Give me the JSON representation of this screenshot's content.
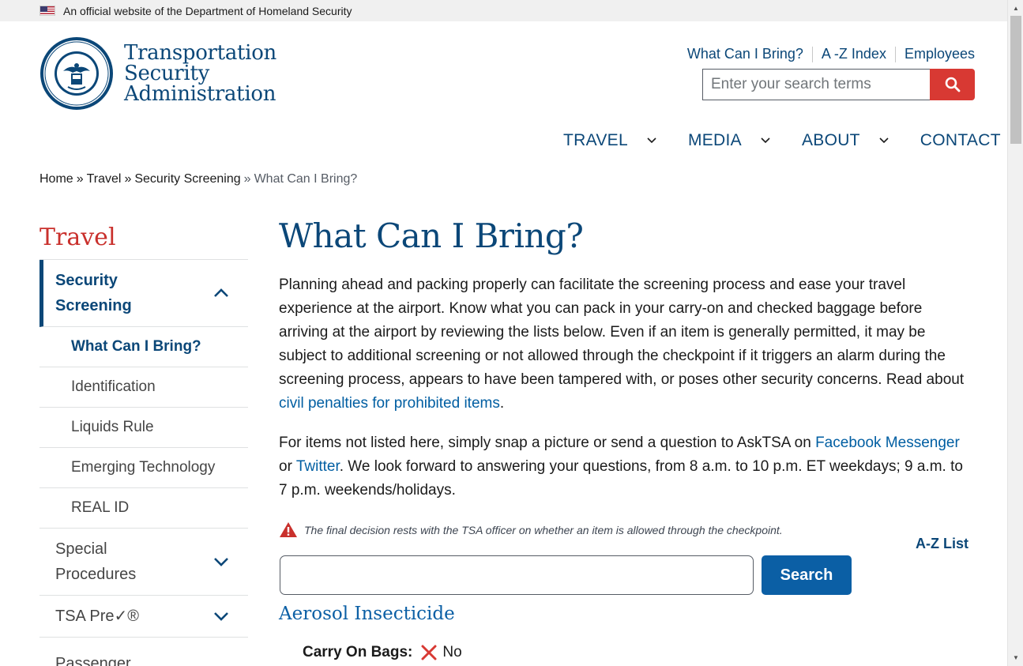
{
  "banner": {
    "text": "An official website of the Department of Homeland Security"
  },
  "logo": {
    "line1": "Transportation",
    "line2": "Security",
    "line3": "Administration"
  },
  "utility_links": [
    {
      "label": "What Can I Bring?"
    },
    {
      "label": "A -Z Index"
    },
    {
      "label": "Employees"
    }
  ],
  "site_search": {
    "placeholder": "Enter your search terms",
    "value": ""
  },
  "nav": [
    {
      "label": "TRAVEL",
      "has_dropdown": true
    },
    {
      "label": "MEDIA",
      "has_dropdown": true
    },
    {
      "label": "ABOUT",
      "has_dropdown": true
    },
    {
      "label": "CONTACT",
      "has_dropdown": false
    }
  ],
  "breadcrumb": [
    {
      "label": "Home"
    },
    {
      "label": "Travel"
    },
    {
      "label": "Security Screening"
    },
    {
      "label": "What Can I Bring?"
    }
  ],
  "breadcrumb_sep": "»",
  "sidebar": {
    "title": "Travel",
    "active_group": "Security Screening",
    "sub_items": [
      {
        "label": "What Can I Bring?",
        "current": true
      },
      {
        "label": "Identification"
      },
      {
        "label": "Liquids Rule"
      },
      {
        "label": "Emerging Technology"
      },
      {
        "label": "REAL ID"
      }
    ],
    "groups": [
      {
        "label": "Special Procedures"
      },
      {
        "label": "TSA Pre✓®"
      },
      {
        "label": "Passenger"
      }
    ]
  },
  "main": {
    "title": "What Can I Bring?",
    "intro": "Planning ahead and packing properly can facilitate the screening process and ease your travel experience at the airport. Know what you can pack in your carry-on and checked baggage before arriving at the airport by reviewing the lists below. Even if an item is generally permitted, it may be subject to additional screening or not allowed through the checkpoint if it triggers an alarm during the screening process, appears to have been tampered with, or poses other security concerns. Read about ",
    "intro_link": "civil penalties for prohibited items",
    "intro_end": ".",
    "contact_pre": "For items not listed here, simply snap a picture or send a question to AskTSA on ",
    "contact_link1": "Facebook Messenger",
    "contact_mid": " or ",
    "contact_link2": "Twitter",
    "contact_post": ". We look forward to answering your questions, from 8 a.m. to 10 p.m. ET weekdays; 9 a.m. to 7 p.m. weekends/holidays.",
    "warning": "The final decision rests with the TSA officer on whether an item is allowed through the checkpoint.",
    "az_link": "A-Z List",
    "item_search": {
      "value": "",
      "button": "Search"
    },
    "result": {
      "title": "Aerosol Insecticide",
      "carry_on_label": "Carry On Bags:",
      "carry_on_value": "No"
    }
  },
  "colors": {
    "primary": "#0b4778",
    "accent_red": "#d83933",
    "link": "#005ea2",
    "button_blue": "#0b5fa5"
  }
}
